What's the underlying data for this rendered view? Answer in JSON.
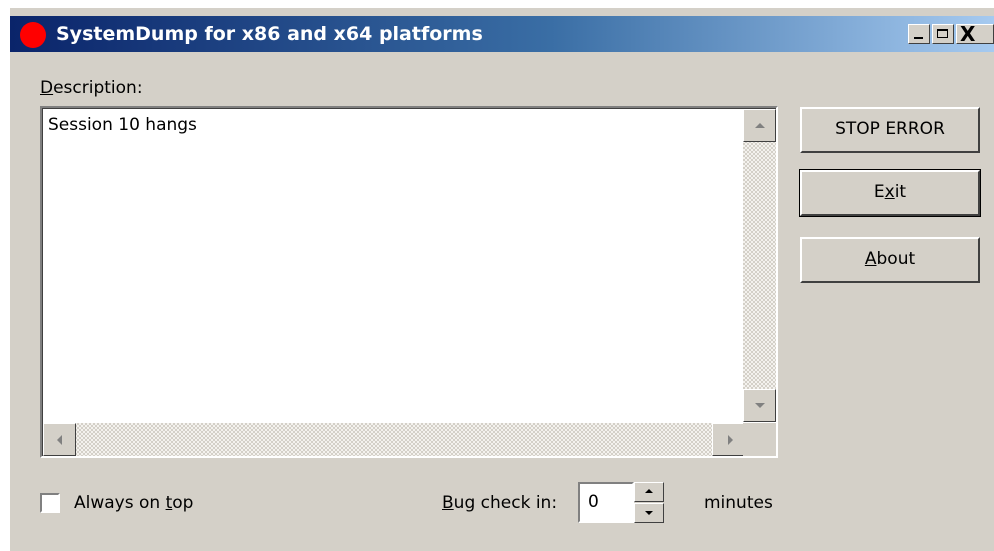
{
  "window": {
    "title": "SystemDump for x86 and x64 platforms",
    "controls": {
      "minimize": "minimize",
      "maximize": "maximize",
      "close": "X"
    }
  },
  "description": {
    "label_prefix": "",
    "label_mnemonic": "D",
    "label_rest": "escription:",
    "value": "Session 10 hangs"
  },
  "buttons": {
    "stop_error": "STOP ERROR",
    "exit_before": "E",
    "exit_mnemonic": "x",
    "exit_after": "it",
    "about_mnemonic": "A",
    "about_rest": "bout"
  },
  "footer": {
    "always_on_top_before": "Always on ",
    "always_on_top_mnemonic": "t",
    "always_on_top_after": "op",
    "always_on_top_checked": false,
    "bug_check_mnemonic": "B",
    "bug_check_rest": "ug check in:",
    "bug_check_value": "0",
    "minutes_label": "minutes"
  },
  "colors": {
    "dialog_bg": "#d4d0c8",
    "titlebar_start": "#0a246a",
    "titlebar_end": "#a6caf0",
    "title_icon": "#ff0000"
  },
  "icons": {
    "app": "red-circle-icon",
    "scroll_up": "arrow-up-icon",
    "scroll_down": "arrow-down-icon",
    "scroll_left": "arrow-left-icon",
    "scroll_right": "arrow-right-icon"
  }
}
